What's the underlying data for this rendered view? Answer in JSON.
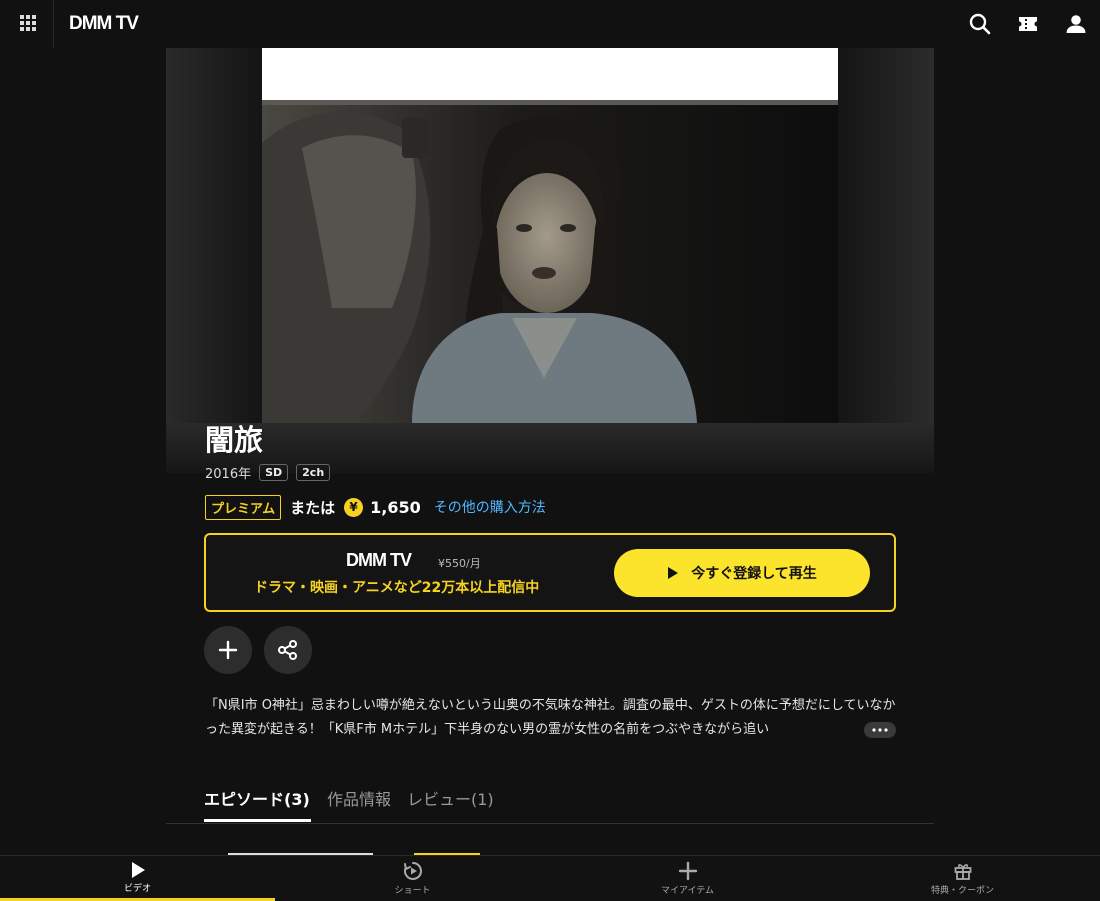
{
  "header": {
    "logo": "DMM TV",
    "icons": [
      "grid-menu-icon",
      "search-icon",
      "ticket-icon",
      "user-icon"
    ]
  },
  "hero": {
    "image": "dark car-interior still of a woman"
  },
  "title": "闇旅",
  "meta": {
    "year": "2016年",
    "badges": [
      "SD",
      "2ch"
    ]
  },
  "pricing": {
    "premium_label": "プレミアム",
    "or_text": "または",
    "yen_symbol": "¥",
    "price": "1,650",
    "other_purchase": "その他の購入方法"
  },
  "promo": {
    "logo": "DMM TV",
    "price": "¥550/月",
    "text": "ドラマ・映画・アニメなど22万本以上配信中",
    "cta_label": "今すぐ登録して再生"
  },
  "actions": [
    "add-icon",
    "share-icon"
  ],
  "description": "「N県I市 O神社」忌まわしい噂が絶えないという山奥の不気味な神社。調査の最中、ゲストの体に予想だにしていなかった異変が起きる！「K県F市 Mホテル」下半身のない男の霊が女性の名前をつぶやきながら追い",
  "tabs": [
    {
      "label": "エピソード(3)",
      "active": true
    },
    {
      "label": "作品情報",
      "active": false
    },
    {
      "label": "レビュー(1)",
      "active": false
    }
  ],
  "bottom_nav": [
    {
      "label": "ビデオ",
      "icon": "play-icon",
      "active": true
    },
    {
      "label": "ショート",
      "icon": "short-play-icon",
      "active": false
    },
    {
      "label": "マイアイテム",
      "icon": "plus-icon",
      "active": false
    },
    {
      "label": "特典・クーポン",
      "icon": "gift-icon",
      "active": false
    }
  ],
  "colors": {
    "accent": "#f5d220",
    "background": "#111111",
    "link": "#4fb7ff"
  }
}
